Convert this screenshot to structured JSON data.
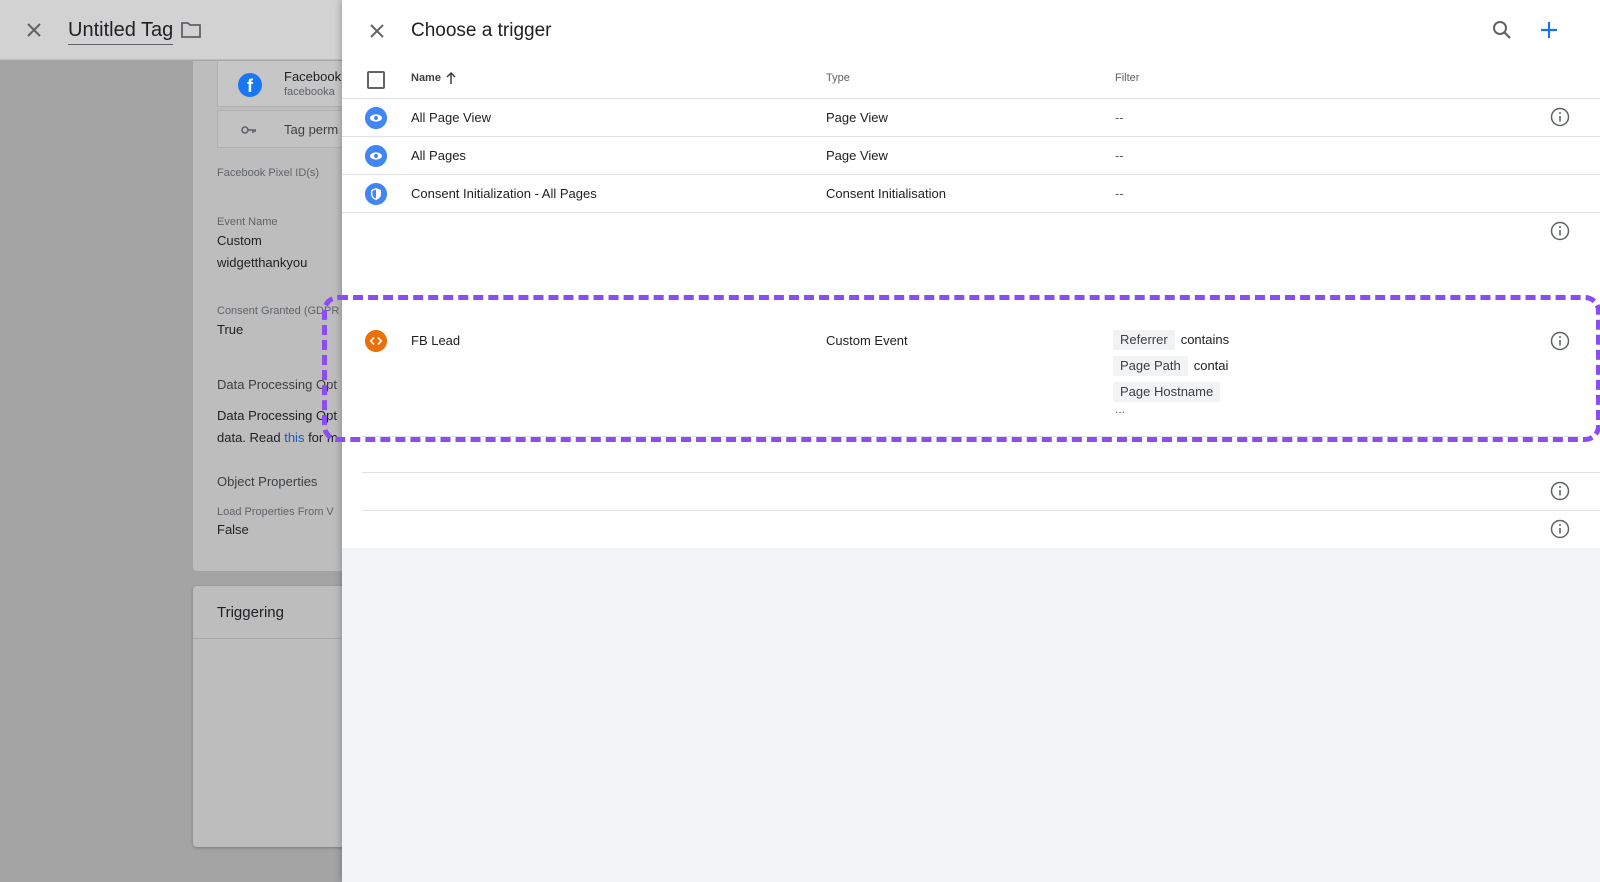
{
  "background": {
    "title": "Untitled Tag",
    "facebook": {
      "name": "Facebook",
      "sub": "facebooka"
    },
    "tag_permissions": "Tag perm",
    "fields": [
      {
        "label": "Facebook Pixel ID(s)"
      },
      {
        "label": "Event Name",
        "values": [
          "Custom",
          "widgetthankyou"
        ]
      },
      {
        "label": "Consent Granted (GDPR",
        "values": [
          "True"
        ]
      }
    ],
    "data_processing_heading": "Data Processing Opt",
    "data_processing_text1": "Data Processing Opt",
    "data_processing_text2a": "data. Read ",
    "data_processing_link": "this",
    "data_processing_text2b": " for m",
    "object_properties": "Object Properties",
    "load_properties_label": "Load Properties From V",
    "load_properties_value": "False",
    "triggering": "Triggering"
  },
  "drawer": {
    "title": "Choose a trigger",
    "columns": {
      "name": "Name",
      "type": "Type",
      "filter": "Filter"
    },
    "rows": [
      {
        "name": "All Page View",
        "type": "Page View",
        "filter": "--",
        "icon": "eye-icon"
      },
      {
        "name": "All Pages",
        "type": "Page View",
        "filter": "--",
        "icon": "eye-icon"
      },
      {
        "name": "Consent Initialization - All Pages",
        "type": "Consent Initialisation",
        "filter": "--",
        "icon": "shield-icon"
      },
      {
        "name": "FB Lead",
        "type": "Custom Event",
        "icon": "code-icon",
        "filters": [
          {
            "field": "Referrer",
            "op": "contains"
          },
          {
            "field": "Page Path",
            "op": "contai"
          },
          {
            "field": "Page Hostname",
            "op": ""
          }
        ],
        "more": "..."
      }
    ]
  },
  "colors": {
    "accent_blue": "#4285f4",
    "custom_event_orange": "#e8710a",
    "highlight_purple": "#8c4df0",
    "link_blue": "#1a56c9"
  }
}
